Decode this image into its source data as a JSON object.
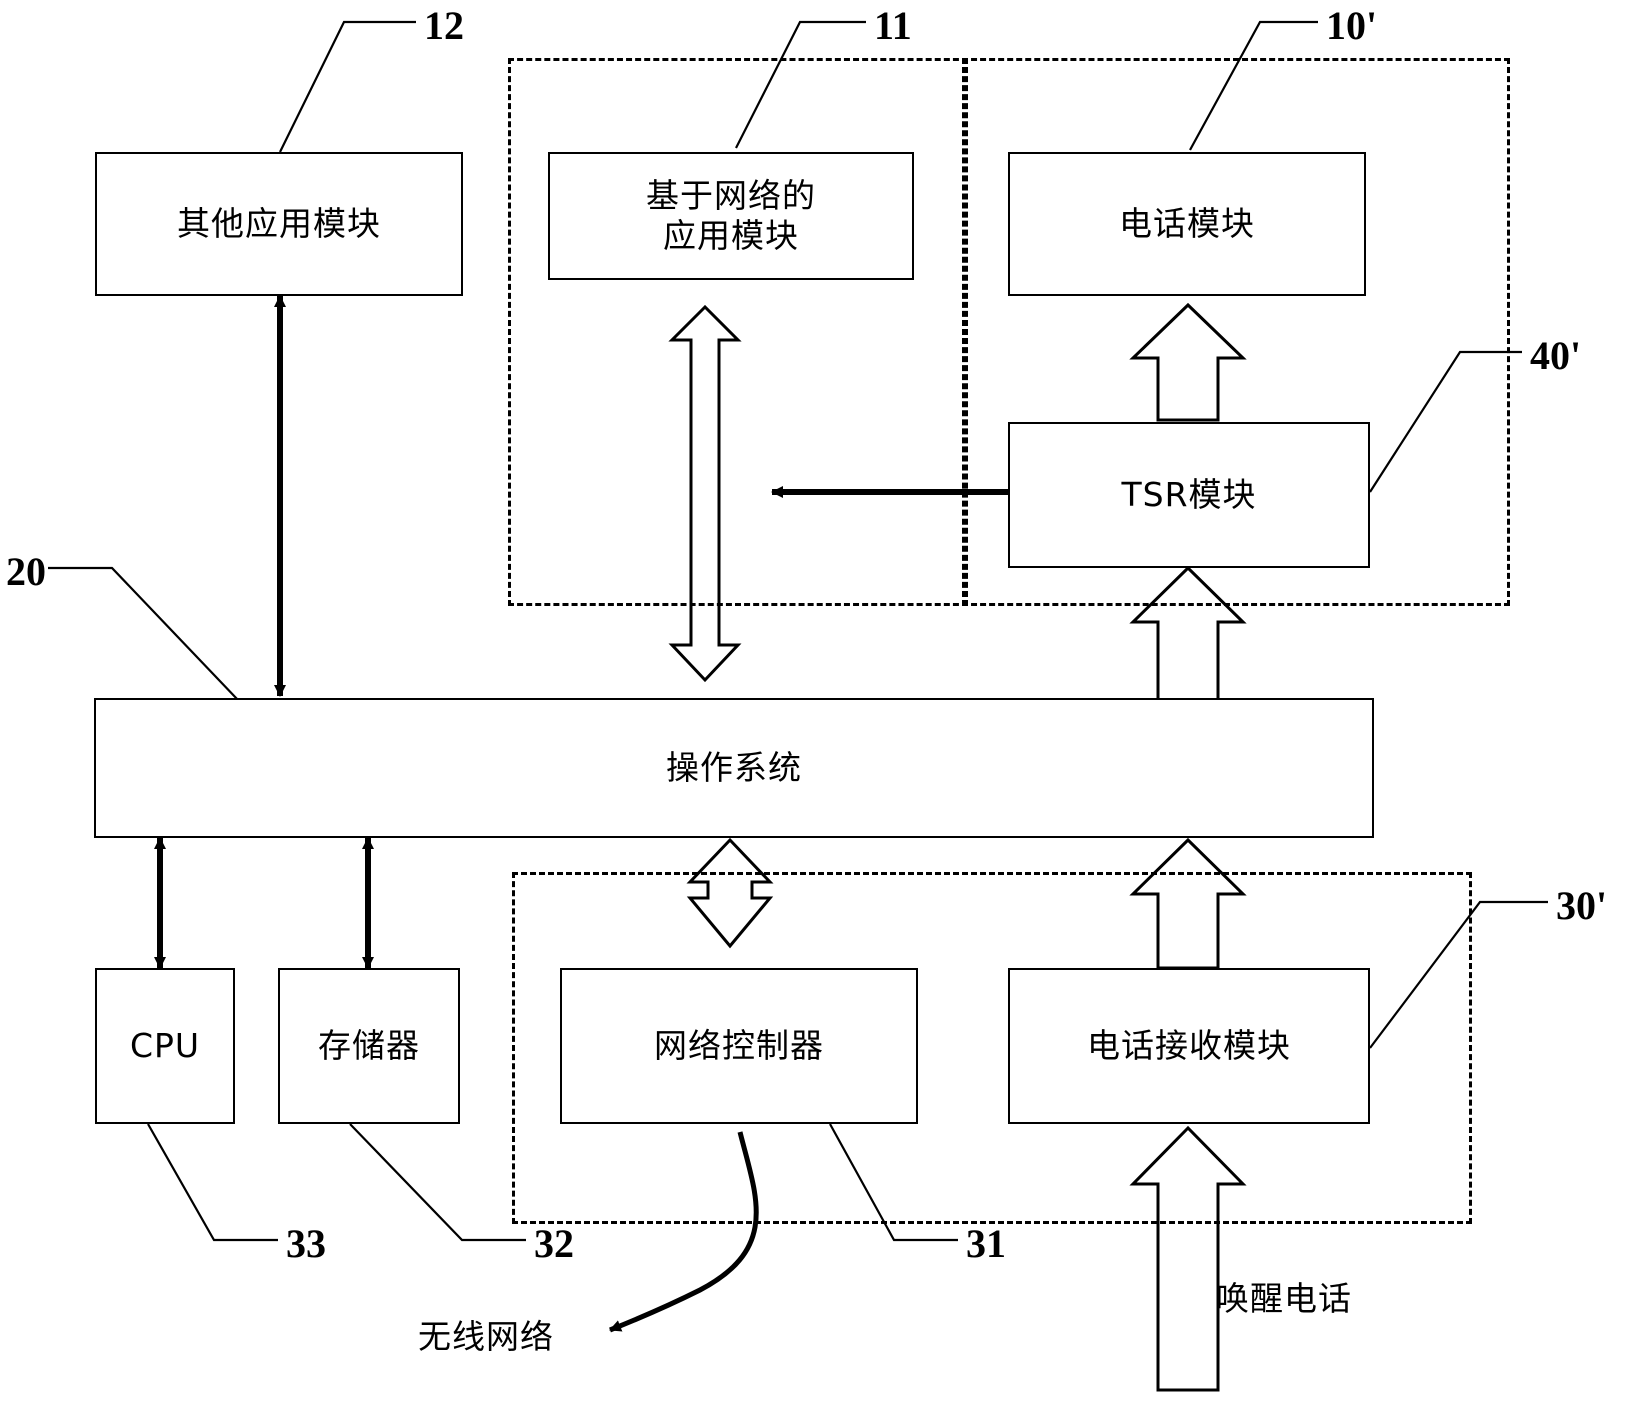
{
  "figure": {
    "type": "patent-block-diagram",
    "background": "#ffffff",
    "line_color": "#000000"
  },
  "blocks": {
    "other_app": {
      "label": "其他应用模块",
      "ref": "12"
    },
    "network_app": {
      "label": "基于网络的\n应用模块",
      "ref": "11"
    },
    "phone_module": {
      "label": "电话模块",
      "ref": "10'"
    },
    "tsr_module": {
      "label": "TSR模块",
      "ref": "40'"
    },
    "operating_system": {
      "label": "操作系统",
      "ref": "20"
    },
    "cpu": {
      "label": "CPU",
      "ref": "33"
    },
    "memory": {
      "label": "存储器",
      "ref": "32"
    },
    "network_controller": {
      "label": "网络控制器",
      "ref": "31"
    },
    "phone_receiver": {
      "label": "电话接收模块",
      "ref": "30'"
    }
  },
  "refs": {
    "r12": "12",
    "r11": "11",
    "r10p": "10'",
    "r40p": "40'",
    "r20": "20",
    "r33": "33",
    "r32": "32",
    "r31": "31",
    "r30p": "30'"
  },
  "annotations": {
    "wireless_network": "无线网络",
    "wakeup_call": "唤醒电话"
  }
}
